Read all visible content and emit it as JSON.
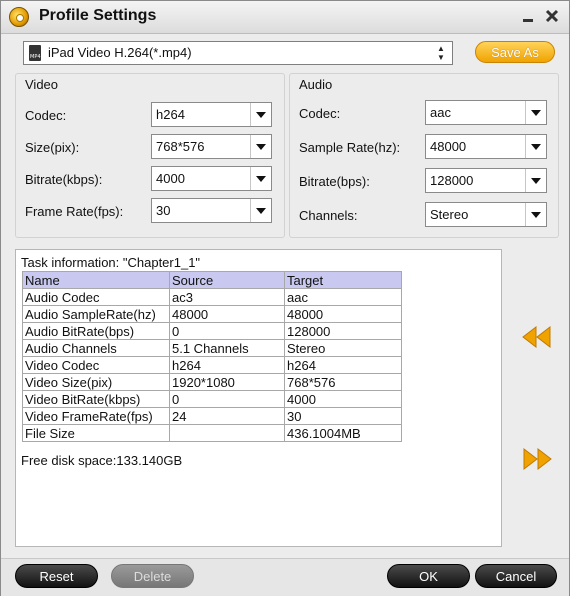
{
  "window": {
    "title": "Profile Settings"
  },
  "profile": {
    "selected": "iPad Video H.264(*.mp4)",
    "save_as_label": "Save As"
  },
  "video": {
    "section_label": "Video",
    "codec": {
      "label": "Codec:",
      "value": "h264"
    },
    "size": {
      "label": "Size(pix):",
      "value": "768*576"
    },
    "bitrate": {
      "label": "Bitrate(kbps):",
      "value": "4000"
    },
    "frame_rate": {
      "label": "Frame Rate(fps):",
      "value": "30"
    }
  },
  "audio": {
    "section_label": "Audio",
    "codec": {
      "label": "Codec:",
      "value": "aac"
    },
    "sample_rate": {
      "label": "Sample Rate(hz):",
      "value": "48000"
    },
    "bitrate": {
      "label": "Bitrate(bps):",
      "value": "128000"
    },
    "channels": {
      "label": "Channels:",
      "value": "Stereo"
    }
  },
  "task": {
    "info_label": "Task information: \"Chapter1_1\"",
    "headers": [
      "Name",
      "Source",
      "Target"
    ],
    "rows": [
      [
        "Audio Codec",
        "ac3",
        "aac"
      ],
      [
        "Audio SampleRate(hz)",
        "48000",
        "48000"
      ],
      [
        "Audio BitRate(bps)",
        "0",
        "128000"
      ],
      [
        "Audio Channels",
        "5.1 Channels",
        "Stereo"
      ],
      [
        "Video Codec",
        "h264",
        "h264"
      ],
      [
        "Video Size(pix)",
        "1920*1080",
        "768*576"
      ],
      [
        "Video BitRate(kbps)",
        "0",
        "4000"
      ],
      [
        "Video FrameRate(fps)",
        "24",
        "30"
      ],
      [
        "File Size",
        "",
        "436.1004MB"
      ]
    ],
    "free_disk_space": "Free disk space:133.140GB"
  },
  "buttons": {
    "reset": "Reset",
    "delete": "Delete",
    "ok": "OK",
    "cancel": "Cancel"
  },
  "colors": {
    "accent": "#f0a300",
    "table_header": "#c8c8f0"
  }
}
